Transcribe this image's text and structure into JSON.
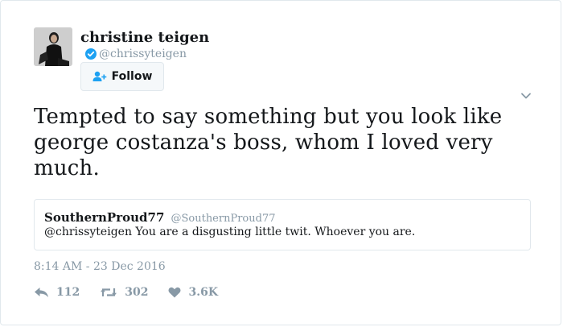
{
  "author": {
    "name": "christine teigen",
    "handle": "@chrissyteigen",
    "verified": true,
    "avatar_icon": "profile-photo"
  },
  "follow_button": {
    "label": "Follow",
    "icon": "add-user-icon"
  },
  "tweet": {
    "text": "Tempted to say something but you look like george costanza's boss, whom I loved very much."
  },
  "quoted_tweet": {
    "name": "SouthernProud77",
    "handle": "@SouthernProud77",
    "text": "@chrissyteigen You are a disgusting little twit. Whoever you are."
  },
  "timestamp": "8:14 AM - 23 Dec 2016",
  "actions": {
    "reply": {
      "icon": "reply-icon",
      "count": "112"
    },
    "retweet": {
      "icon": "retweet-icon",
      "count": "302"
    },
    "like": {
      "icon": "heart-icon",
      "count": "3.6K"
    }
  },
  "colors": {
    "text": "#14171a",
    "secondary": "#8899a6",
    "verified_blue": "#1da1f2",
    "border": "#e1e8ed"
  }
}
